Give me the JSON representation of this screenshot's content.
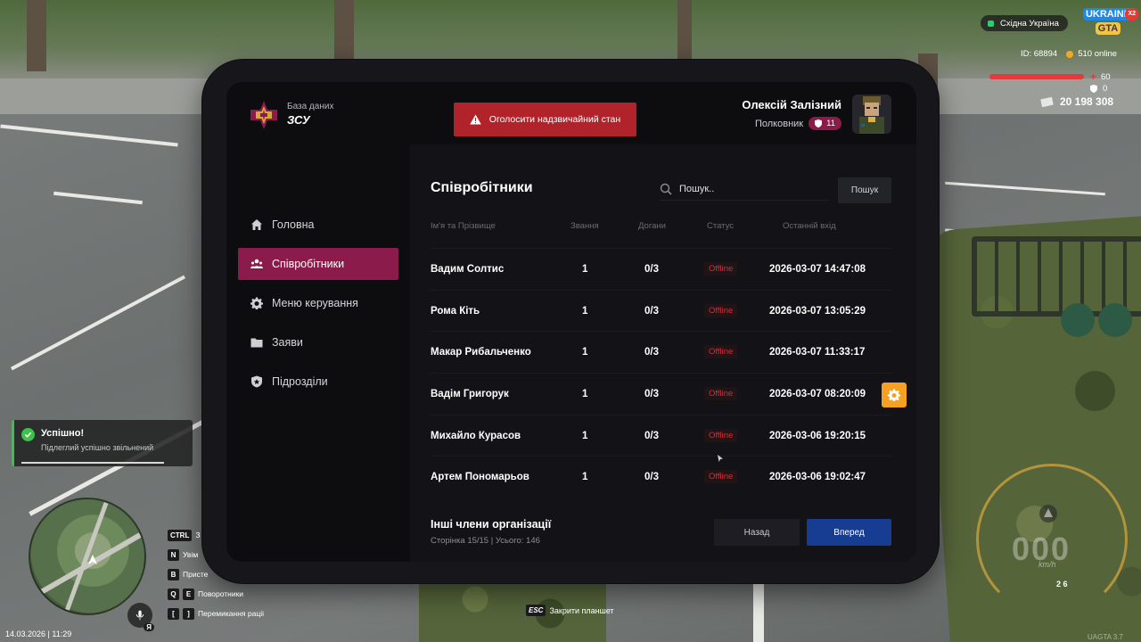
{
  "app": {
    "brand_subtitle": "База даних",
    "brand_title": "ЗСУ",
    "emergency_label": "Оголосити надзвичайний стан"
  },
  "user": {
    "name": "Олексій Залізний",
    "rank": "Полковник",
    "rank_level": "11"
  },
  "sidebar": {
    "items": [
      {
        "label": "Головна",
        "icon": "home-icon",
        "active": false
      },
      {
        "label": "Співробітники",
        "icon": "users-icon",
        "active": true
      },
      {
        "label": "Меню керування",
        "icon": "gear-icon",
        "active": false
      },
      {
        "label": "Заяви",
        "icon": "folder-icon",
        "active": false
      },
      {
        "label": "Підрозділи",
        "icon": "shield-icon",
        "active": false
      }
    ]
  },
  "employees": {
    "title": "Співробітники",
    "search_placeholder": "Пошук..",
    "search_button": "Пошук",
    "columns": [
      "Ім'я та Прізвище",
      "Звання",
      "Догани",
      "Статус",
      "Останній вхід"
    ],
    "rows": [
      {
        "name": "Вадим Солтис",
        "rank": "1",
        "warnings": "0/3",
        "status": "Offline",
        "last_login": "2026-03-07 14:47:08"
      },
      {
        "name": "Рома Кіть",
        "rank": "1",
        "warnings": "0/3",
        "status": "Offline",
        "last_login": "2026-03-07 13:05:29"
      },
      {
        "name": "Макар Рибальченко",
        "rank": "1",
        "warnings": "0/3",
        "status": "Offline",
        "last_login": "2026-03-07 11:33:17"
      },
      {
        "name": "Вадім Григорук",
        "rank": "1",
        "warnings": "0/3",
        "status": "Offline",
        "last_login": "2026-03-07 08:20:09"
      },
      {
        "name": "Михайло Курасов",
        "rank": "1",
        "warnings": "0/3",
        "status": "Offline",
        "last_login": "2026-03-06 19:20:15"
      },
      {
        "name": "Артем Пономарьов",
        "rank": "1",
        "warnings": "0/3",
        "status": "Offline",
        "last_login": "2026-03-06 19:02:47"
      }
    ],
    "footer_title": "Інші члени організації",
    "footer_info": "Сторінка 15/15 | Усього: 146",
    "back_label": "Назад",
    "next_label": "Вперед"
  },
  "hud": {
    "region": "Східна Україна",
    "logo_top": "UKRAINE",
    "logo_bottom": "GTA",
    "logo_badge": "X2",
    "player_id": "ID: 68894",
    "online": "510 online",
    "health": "60",
    "armor": "0",
    "money": "20 198 308",
    "toast_title": "Успішно!",
    "toast_text": "Підлеглий успішно звільнений",
    "keyhints": [
      {
        "keys": [
          "CTRL"
        ],
        "label": "З"
      },
      {
        "keys": [
          "N"
        ],
        "label": "Увім"
      },
      {
        "keys": [
          "B"
        ],
        "label": "Присте"
      },
      {
        "keys": [
          "Q",
          "E"
        ],
        "label": "Поворотники"
      },
      {
        "keys": [
          "[",
          "]"
        ],
        "label": "Перемикання раціі"
      }
    ],
    "mic_label": "Я",
    "datetime": "14.03.2026 | 11:29",
    "esc_key": "ESC",
    "esc_label": "Закрити планшет",
    "speed": "000",
    "speed_unit": "km/h",
    "gears": "2 6",
    "version": "UAGTA 3.7"
  }
}
